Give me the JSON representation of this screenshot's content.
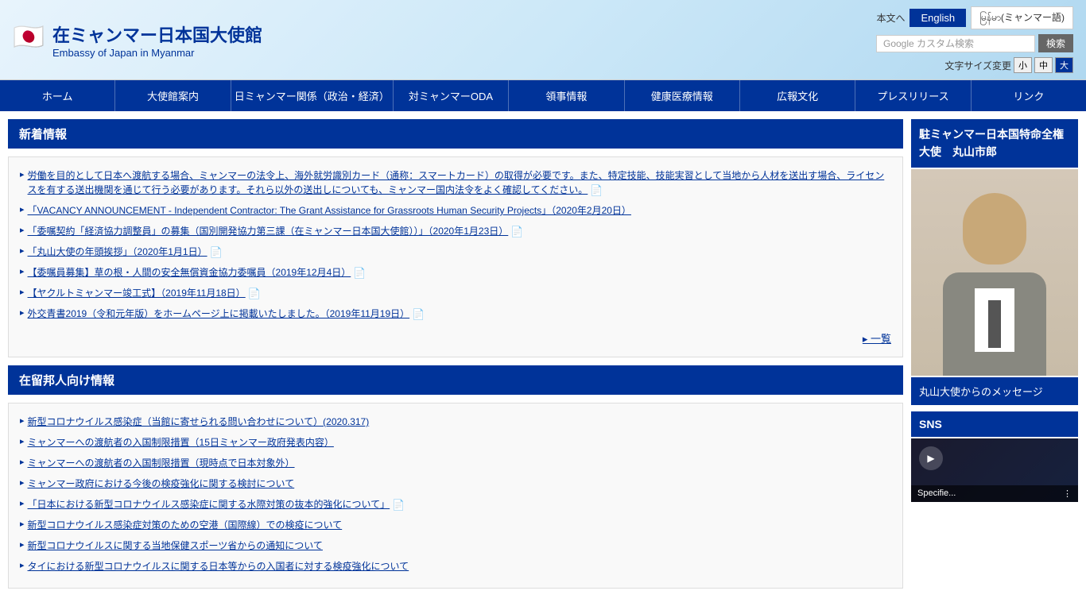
{
  "header": {
    "flag": "🇯🇵",
    "title_jp": "在ミャンマー日本国大使館",
    "title_en": "Embassy of Japan in Myanmar",
    "lang": {
      "honbun": "本文へ",
      "english": "English",
      "myanmar": "မြန်မာ(ミャンマー語)"
    },
    "search": {
      "placeholder": "Google カスタム検索",
      "button": "検索"
    },
    "font_size": {
      "label": "文字サイズ変更",
      "small": "小",
      "medium": "中",
      "large": "大"
    }
  },
  "nav": {
    "items": [
      "ホーム",
      "大使館案内",
      "日ミャンマー関係（政治・経済）",
      "対ミャンマーODA",
      "領事情報",
      "健康医療情報",
      "広報文化",
      "プレスリリース",
      "リンク"
    ]
  },
  "news_section": {
    "title": "新着情報",
    "items": [
      {
        "text": "労働を目的として日本へ渡航する場合、ミャンマーの法令上、海外就労識別カード（通称：スマートカード）の取得が必要です。また、特定技能、技能実習として当地から人材を送出す場合、ライセンスを有する送出機関を通じて行う必要があります。それら以外の送出しについても、ミャンマー国内法令をよく確認してください。",
        "has_doc": true
      },
      {
        "text": "「VACANCY ANNOUNCEMENT - Independent Contractor: The Grant Assistance for Grassroots Human Security Projects」（2020年2月20日）",
        "has_doc": false
      },
      {
        "text": "「委嘱契約「経済協力調整員」の募集（国別開発協力第三課（在ミャンマー日本国大使館））」（2020年1月23日）",
        "has_doc": true
      },
      {
        "text": "「丸山大使の年頭挨拶」（2020年1月1日）",
        "has_doc": true
      },
      {
        "text": "【委嘱員募集】草の根・人間の安全無償資金協力委嘱員（2019年12月4日）",
        "has_doc": true
      },
      {
        "text": "【ヤクルトミャンマー竣工式】（2019年11月18日）",
        "has_doc": true
      },
      {
        "text": "外交青書2019（令和元年版）をホームページ上に掲載いたしました。（2019年11月19日）",
        "has_doc": true
      }
    ],
    "more_label": "一覧"
  },
  "residents_section": {
    "title": "在留邦人向け情報",
    "items": [
      {
        "text": "新型コロナウイルス感染症（当館に寄せられる問い合わせについて）(2020.317)",
        "has_doc": false
      },
      {
        "text": "ミャンマーへの渡航者の入国制限措置（15日ミャンマー政府発表内容）",
        "has_doc": false
      },
      {
        "text": "ミャンマーへの渡航者の入国制限措置（現時点で日本対象外）",
        "has_doc": false
      },
      {
        "text": "ミャンマー政府における今後の検疫強化に関する検討について",
        "has_doc": false
      },
      {
        "text": "「日本における新型コロナウイルス感染症に関する水際対策の抜本的強化について」",
        "has_doc": true
      },
      {
        "text": "新型コロナウイルス感染症対策のための空港（国際線）での検疫について",
        "has_doc": false
      },
      {
        "text": "新型コロナウイルスに関する当地保健スポーツ省からの通知について",
        "has_doc": false
      },
      {
        "text": "タイにおける新型コロナウイルスに関する日本等からの入国者に対する検疫強化について",
        "has_doc": false
      }
    ]
  },
  "sidebar": {
    "ambassador_title": "駐ミャンマー日本国特命全権大使　丸山市郎",
    "ambassador_msg": "丸山大使からのメッセージ",
    "sns_title": "SNS",
    "video_label": "Specifie...",
    "video_dots": "⋮"
  }
}
